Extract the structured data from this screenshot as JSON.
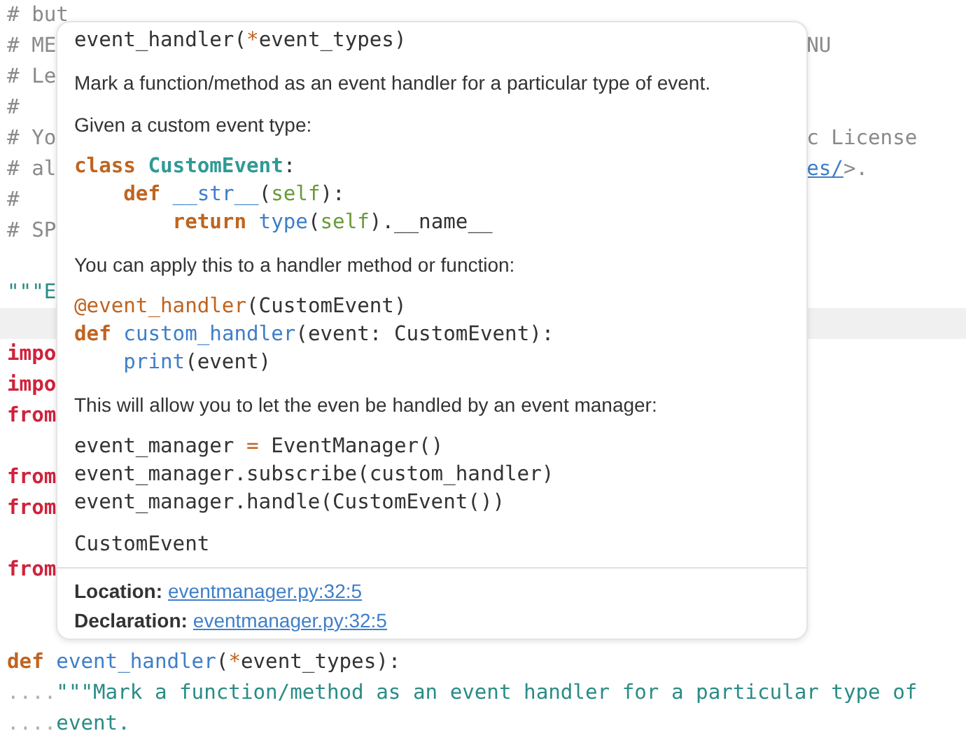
{
  "editor": {
    "lines": [
      {
        "current": false,
        "left": [
          {
            "kind": "comment",
            "text": "# but"
          }
        ]
      },
      {
        "current": false,
        "left": [
          {
            "kind": "comment",
            "text": "# ME"
          }
        ],
        "right": [
          {
            "kind": "comment",
            "text": "NU"
          }
        ]
      },
      {
        "current": false,
        "left": [
          {
            "kind": "comment",
            "text": "# Le"
          }
        ]
      },
      {
        "current": false,
        "left": [
          {
            "kind": "comment",
            "text": "#"
          }
        ]
      },
      {
        "current": false,
        "left": [
          {
            "kind": "comment",
            "text": "# Yo"
          }
        ],
        "right": [
          {
            "kind": "comment",
            "text": "c License"
          }
        ]
      },
      {
        "current": false,
        "left": [
          {
            "kind": "comment",
            "text": "# al"
          }
        ],
        "right": [
          {
            "kind": "link",
            "text": "es/"
          },
          {
            "kind": "comment",
            "text": ">."
          }
        ]
      },
      {
        "current": false,
        "left": [
          {
            "kind": "comment",
            "text": "#"
          }
        ]
      },
      {
        "current": false,
        "left": [
          {
            "kind": "comment",
            "text": "# SP"
          }
        ]
      },
      {
        "current": false
      },
      {
        "current": false,
        "left": [
          {
            "kind": "docstring",
            "text": "\"\"\"E"
          }
        ]
      },
      {
        "current": true
      },
      {
        "current": false,
        "left": [
          {
            "kind": "import",
            "text": "impo"
          }
        ]
      },
      {
        "current": false,
        "left": [
          {
            "kind": "import",
            "text": "impo"
          }
        ]
      },
      {
        "current": false,
        "left": [
          {
            "kind": "import",
            "text": "from"
          }
        ]
      },
      {
        "current": false
      },
      {
        "current": false,
        "left": [
          {
            "kind": "import",
            "text": "from"
          }
        ]
      },
      {
        "current": false,
        "left": [
          {
            "kind": "import",
            "text": "from"
          }
        ]
      },
      {
        "current": false
      },
      {
        "current": false,
        "left": [
          {
            "kind": "import",
            "text": "from"
          }
        ]
      },
      {
        "current": false
      },
      {
        "current": false
      },
      {
        "current": false,
        "left": [
          {
            "kind": "keyword",
            "text": "def "
          },
          {
            "kind": "func",
            "text": "event_handler"
          },
          {
            "kind": "plain",
            "text": "("
          },
          {
            "kind": "op",
            "text": "*"
          },
          {
            "kind": "plain",
            "text": "event_types):"
          }
        ]
      },
      {
        "current": false,
        "left": [
          {
            "kind": "whitespace",
            "text": "...."
          },
          {
            "kind": "docstring",
            "text": "\"\"\"Mark a function/method as an event handler for a particular type of"
          }
        ]
      },
      {
        "current": false,
        "left": [
          {
            "kind": "whitespace",
            "text": "...."
          },
          {
            "kind": "docstring",
            "text": "event."
          }
        ]
      }
    ]
  },
  "popup": {
    "signature": [
      {
        "kind": "plain",
        "text": "event_handler("
      },
      {
        "kind": "op",
        "text": "*"
      },
      {
        "kind": "plain",
        "text": "event_types)"
      }
    ],
    "blocks": [
      {
        "kind": "text",
        "text": "Mark a function/method as an event handler for a particular type of event."
      },
      {
        "kind": "text",
        "text": "Given a custom event type:"
      },
      {
        "kind": "code",
        "lines": [
          [
            {
              "kind": "keyword",
              "text": "class "
            },
            {
              "kind": "class",
              "text": "CustomEvent"
            },
            {
              "kind": "plain",
              "text": ":"
            }
          ],
          [
            {
              "kind": "keyword",
              "text": "    def "
            },
            {
              "kind": "func",
              "text": "__str__"
            },
            {
              "kind": "plain",
              "text": "("
            },
            {
              "kind": "self",
              "text": "self"
            },
            {
              "kind": "plain",
              "text": "):"
            }
          ],
          [
            {
              "kind": "keyword",
              "text": "        return "
            },
            {
              "kind": "func",
              "text": "type"
            },
            {
              "kind": "plain",
              "text": "("
            },
            {
              "kind": "self",
              "text": "self"
            },
            {
              "kind": "plain",
              "text": ").__name__"
            }
          ]
        ]
      },
      {
        "kind": "text",
        "text": "You can apply this to a handler method or function:"
      },
      {
        "kind": "code",
        "lines": [
          [
            {
              "kind": "decorator",
              "text": "@event_handler"
            },
            {
              "kind": "plain",
              "text": "(CustomEvent)"
            }
          ],
          [
            {
              "kind": "keyword",
              "text": "def "
            },
            {
              "kind": "func",
              "text": "custom_handler"
            },
            {
              "kind": "plain",
              "text": "(event: CustomEvent):"
            }
          ],
          [
            {
              "kind": "func",
              "text": "    print"
            },
            {
              "kind": "plain",
              "text": "(event)"
            }
          ]
        ]
      },
      {
        "kind": "text",
        "text": "This will allow you to let the even be handled by an event manager:"
      },
      {
        "kind": "code",
        "lines": [
          [
            {
              "kind": "plain",
              "text": "event_manager "
            },
            {
              "kind": "op",
              "text": "="
            },
            {
              "kind": "plain",
              "text": " EventManager()"
            }
          ],
          [
            {
              "kind": "plain",
              "text": "event_manager.subscribe(custom_handler)"
            }
          ],
          [
            {
              "kind": "plain",
              "text": "event_manager.handle(CustomEvent())"
            }
          ]
        ]
      },
      {
        "kind": "code",
        "lines": [
          [
            {
              "kind": "plain",
              "text": "CustomEvent"
            }
          ]
        ]
      }
    ],
    "footer": [
      {
        "label": "Location:",
        "link": "eventmanager.py:32:5"
      },
      {
        "label": "Declaration:",
        "link": "eventmanager.py:32:5"
      }
    ]
  }
}
